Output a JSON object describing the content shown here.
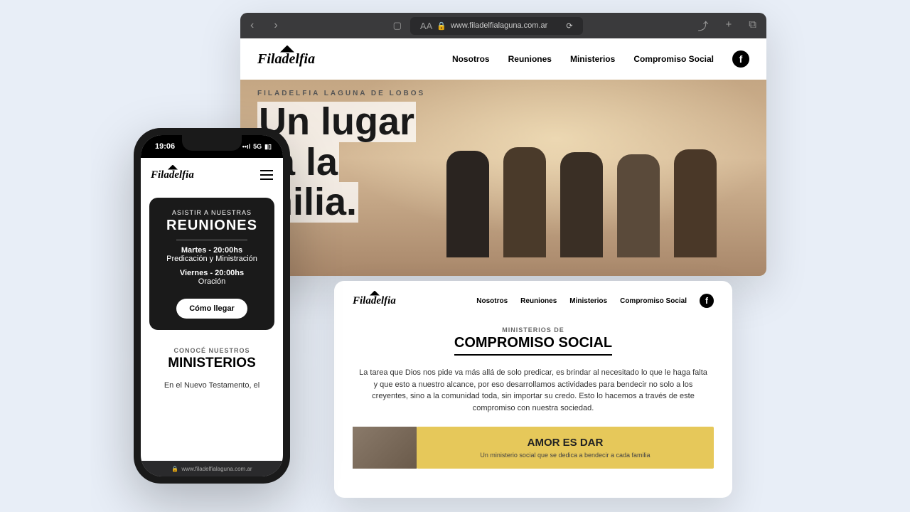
{
  "browser": {
    "url": "www.filadelfialaguna.com.ar",
    "aa": "AA"
  },
  "nav": {
    "items": [
      "Nosotros",
      "Reuniones",
      "Ministerios",
      "Compromiso Social"
    ]
  },
  "hero": {
    "eyebrow": "FILADELFIA LAGUNA DE LOBOS",
    "line1": "Un lugar",
    "line2": "ra la",
    "line3": "milia."
  },
  "tablet": {
    "eyebrow": "MINISTERIOS DE",
    "title": "COMPROMISO SOCIAL",
    "body": "La tarea que Dios nos pide va más allá de solo predicar, es brindar al necesitado lo que le haga falta y que esto a nuestro alcance, por eso desarrollamos actividades para bendecir no solo a los creyentes, sino a la comunidad toda, sin importar su credo. Esto lo hacemos a través de este compromiso con nuestra sociedad.",
    "yellow_title": "AMOR ES DAR",
    "yellow_sub": "Un ministerio social que se dedica a bendecir a cada familia"
  },
  "phone": {
    "time": "19:06",
    "signal": "5G",
    "url": "www.filadelfialaguna.com.ar",
    "reuniones": {
      "eyebrow": "ASISTIR A NUESTRAS",
      "title": "REUNIONES",
      "day1": "Martes - 20:00hs",
      "desc1": "Predicación y Ministración",
      "day2": "Viernes - 20:00hs",
      "desc2": "Oración",
      "cta": "Cómo llegar"
    },
    "ministerios": {
      "eyebrow": "CONOCÉ NUESTROS",
      "title": "MINISTERIOS",
      "body": "En el Nuevo Testamento, el"
    }
  },
  "logo_text": "Filadelfia"
}
